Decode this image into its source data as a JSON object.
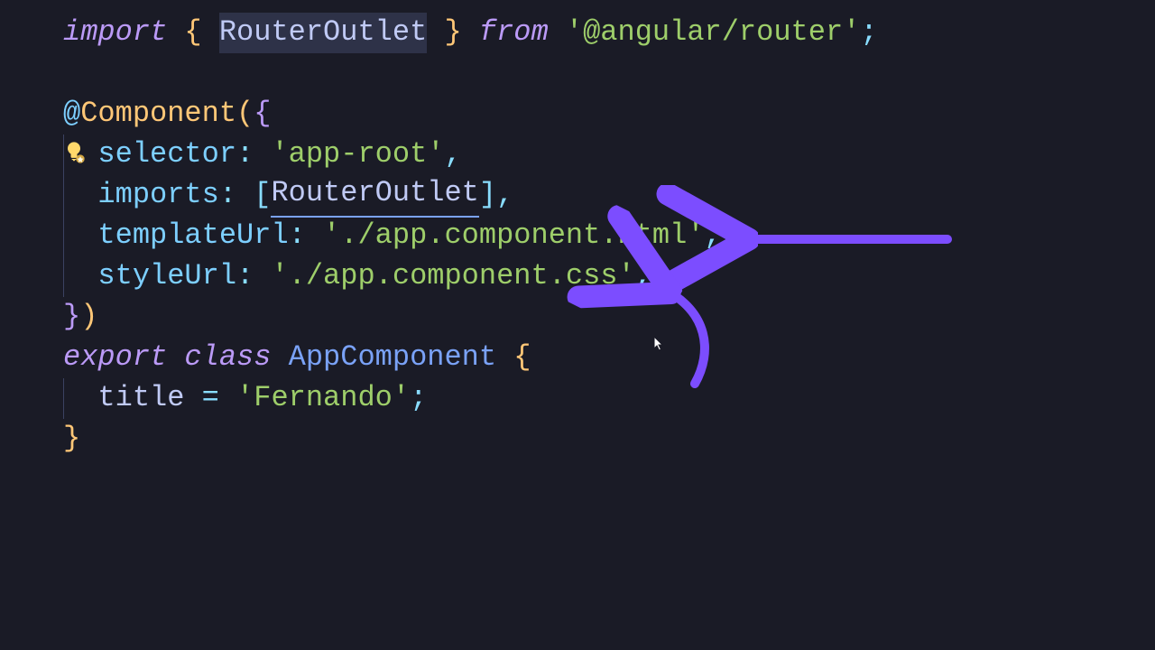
{
  "line1": {
    "kw_import": "import",
    "brace_open": "{",
    "router_outlet": "RouterOutlet",
    "brace_close": "}",
    "kw_from": "from",
    "module": "'@angular/router'",
    "semi": ";"
  },
  "line3": {
    "at": "@",
    "decorator": "Component",
    "paren_open": "(",
    "brace_open": "{"
  },
  "line4": {
    "key": "selector",
    "colon": ":",
    "value": "'app-root'",
    "comma": ","
  },
  "line5": {
    "key": "imports",
    "colon": ":",
    "bracket_open": "[",
    "value": "RouterOutlet",
    "bracket_close": "]",
    "comma": ","
  },
  "line6": {
    "key": "templateUrl",
    "colon": ":",
    "value": "'./app.component.html'",
    "comma": ","
  },
  "line7": {
    "key": "styleUrl",
    "colon": ":",
    "value": "'./app.component.css'",
    "comma": ","
  },
  "line8": {
    "brace_close": "}",
    "paren_close": ")"
  },
  "line9": {
    "kw_export": "export",
    "kw_class": "class",
    "classname": "AppComponent",
    "brace_open": "{"
  },
  "line10": {
    "prop": "title",
    "eq": "=",
    "value": "'Fernando'",
    "semi": ";"
  },
  "line11": {
    "brace_close": "}"
  },
  "annotations": {
    "arrow_color": "#8b5cf6"
  }
}
